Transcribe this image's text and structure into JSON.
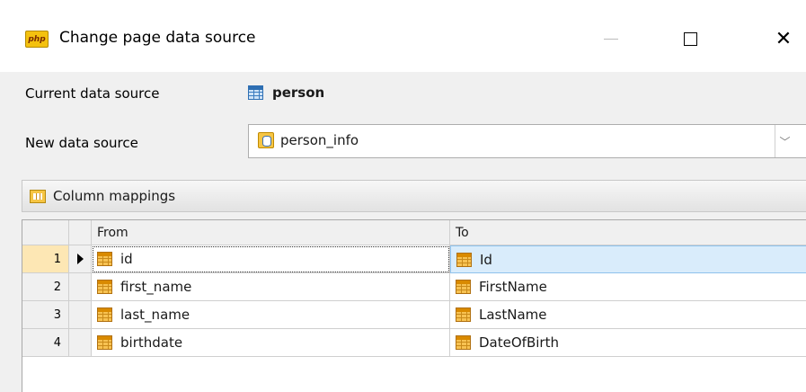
{
  "window": {
    "title": "Change page data source",
    "app_icon_text": "php"
  },
  "form": {
    "current_label": "Current data source",
    "current_value": "person",
    "new_label": "New data source",
    "new_value": "person_info"
  },
  "mappings": {
    "header": "Column mappings",
    "columns": {
      "from": "From",
      "to": "To"
    },
    "rows": [
      {
        "num": "1",
        "from": "id",
        "to": "Id",
        "selected": true
      },
      {
        "num": "2",
        "from": "first_name",
        "to": "FirstName"
      },
      {
        "num": "3",
        "from": "last_name",
        "to": "LastName"
      },
      {
        "num": "4",
        "from": "birthdate",
        "to": "DateOfBirth"
      }
    ]
  },
  "colors": {
    "selected_row": "#d9ecfb",
    "selected_num": "#fde7b4",
    "panel_bg": "#f0f0f0"
  }
}
